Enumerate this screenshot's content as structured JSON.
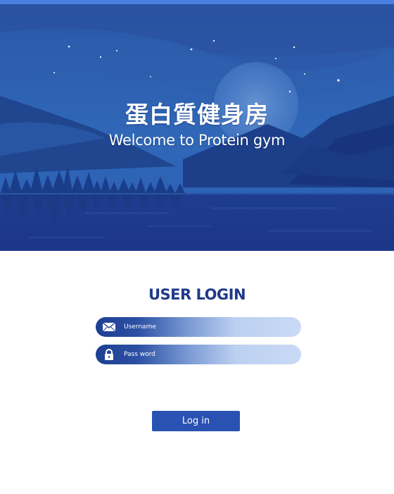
{
  "hero": {
    "title": "蛋白質健身房",
    "subtitle": "Welcome to Protein gym"
  },
  "login": {
    "heading": "USER LOGIN",
    "username": {
      "placeholder": "Username",
      "value": "",
      "icon": "envelope-icon"
    },
    "password": {
      "placeholder": "Pass word",
      "value": "",
      "icon": "lock-icon"
    },
    "submit_label": "Log in"
  },
  "colors": {
    "accent": "#2a52b3",
    "heading": "#1f3a8a",
    "top_stripe": "#4a7fe0",
    "hero_sky": "#2a56a8"
  }
}
